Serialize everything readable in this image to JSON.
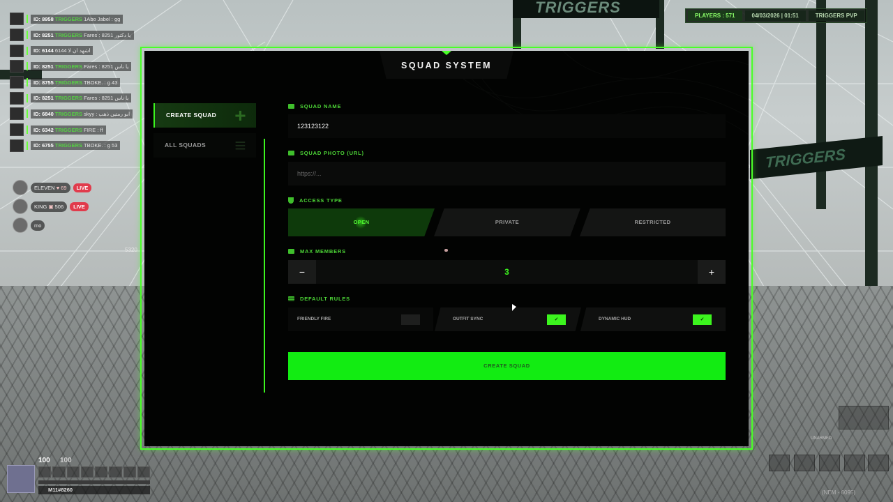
{
  "world": {
    "banner_top": "TRIGGERS",
    "banner_right": "TRIGGERS",
    "distance": "5320"
  },
  "hud_top": {
    "players": "PLAYERS : 571",
    "datetime": "04/03/2026 | 01:51",
    "server": "TRIGGERS PVP"
  },
  "feed": [
    {
      "id": "ID: 8958",
      "tag": "TRIGGERS",
      "name": "1Abo Jabel",
      "msg": "gg"
    },
    {
      "id": "ID: 8251",
      "tag": "TRIGGERS",
      "name": "Fares",
      "msg": "8251 يا دكتور"
    },
    {
      "id": "ID: 6144",
      "tag": "",
      "name": "",
      "msg": "6144 اشهد ان لا"
    },
    {
      "id": "ID: 8251",
      "tag": "TRIGGERS",
      "name": "Fares",
      "msg": "8251 يا ناس"
    },
    {
      "id": "ID: 8755",
      "tag": "TRIGGERS",
      "name": "TBOKE.",
      "msg": "g 43"
    },
    {
      "id": "ID: 8251",
      "tag": "TRIGGERS",
      "name": "Fares",
      "msg": "8251 يا ناس"
    },
    {
      "id": "ID: 6840",
      "tag": "TRIGGERS",
      "name": "skyy",
      "msg": "ابو رمتين ذهب"
    },
    {
      "id": "ID: 6342",
      "tag": "TRIGGERS",
      "name": "FIRE",
      "msg": "ff"
    },
    {
      "id": "ID: 6755",
      "tag": "TRIGGERS",
      "name": "TBOKE.",
      "msg": "g 53"
    }
  ],
  "viewers": [
    {
      "name": "ELEVEN",
      "count": "69",
      "live": "LIVE"
    },
    {
      "name": "KING",
      "count": "506",
      "live": "LIVE"
    },
    {
      "name": "mo",
      "count": "",
      "live": ""
    }
  ],
  "player": {
    "health": "100",
    "armor": "100",
    "name": "M11#8260"
  },
  "weapons": {
    "label": "UNARMED"
  },
  "bottom_right": "(NEM - 6095)",
  "modal": {
    "title": "SQUAD SYSTEM",
    "sidebar": {
      "create": "CREATE SQUAD",
      "all": "ALL SQUADS"
    },
    "squad_name": {
      "label": "SQUAD NAME",
      "value": "123123122"
    },
    "squad_photo": {
      "label": "SQUAD PHOTO (URL)",
      "placeholder": "https://..."
    },
    "access": {
      "label": "ACCESS TYPE",
      "options": [
        "OPEN",
        "PRIVATE",
        "RESTRICTED"
      ],
      "selected": "OPEN"
    },
    "max_members": {
      "label": "MAX MEMBERS",
      "minus": "−",
      "plus": "+",
      "value": "3"
    },
    "rules": {
      "label": "DEFAULT RULES",
      "items": [
        {
          "name": "FRIENDLY FIRE",
          "on": false
        },
        {
          "name": "OUTFIT SYNC",
          "on": true
        },
        {
          "name": "DYNAMIC HUD",
          "on": true
        }
      ],
      "check": "✓"
    },
    "submit": "CREATE SQUAD"
  },
  "colors": {
    "accent": "#3cf51e",
    "submit_bg": "#12ec12",
    "panel_bg": "#020302",
    "live": "#e13b4c"
  }
}
